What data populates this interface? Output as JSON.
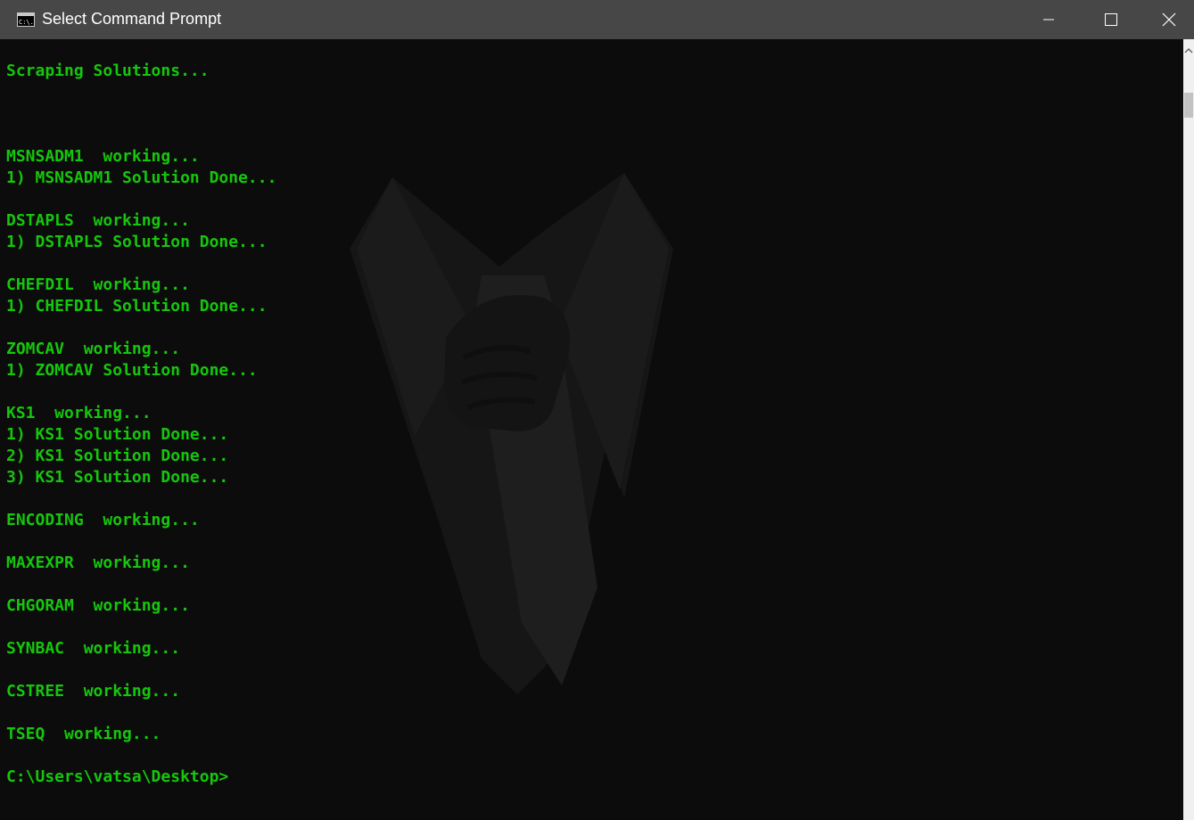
{
  "window": {
    "title": "Select Command Prompt",
    "icon": "cmd-app-icon",
    "buttons": {
      "minimize_icon": "minimize-icon",
      "maximize_icon": "maximize-icon",
      "close_icon": "close-icon"
    }
  },
  "console": {
    "text_color": "#16c60c",
    "background": "#0c0c0c",
    "lines": [
      "Scraping Solutions...",
      "",
      "",
      "",
      "MSNSADM1  working...",
      "1) MSNSADM1 Solution Done...",
      "",
      "DSTAPLS  working...",
      "1) DSTAPLS Solution Done...",
      "",
      "CHEFDIL  working...",
      "1) CHEFDIL Solution Done...",
      "",
      "ZOMCAV  working...",
      "1) ZOMCAV Solution Done...",
      "",
      "KS1  working...",
      "1) KS1 Solution Done...",
      "2) KS1 Solution Done...",
      "3) KS1 Solution Done...",
      "",
      "ENCODING  working...",
      "",
      "MAXEXPR  working...",
      "",
      "CHGORAM  working...",
      "",
      "SYNBAC  working...",
      "",
      "CSTREE  working...",
      "",
      "TSEQ  working...",
      "",
      "C:\\Users\\vatsa\\Desktop>"
    ]
  }
}
